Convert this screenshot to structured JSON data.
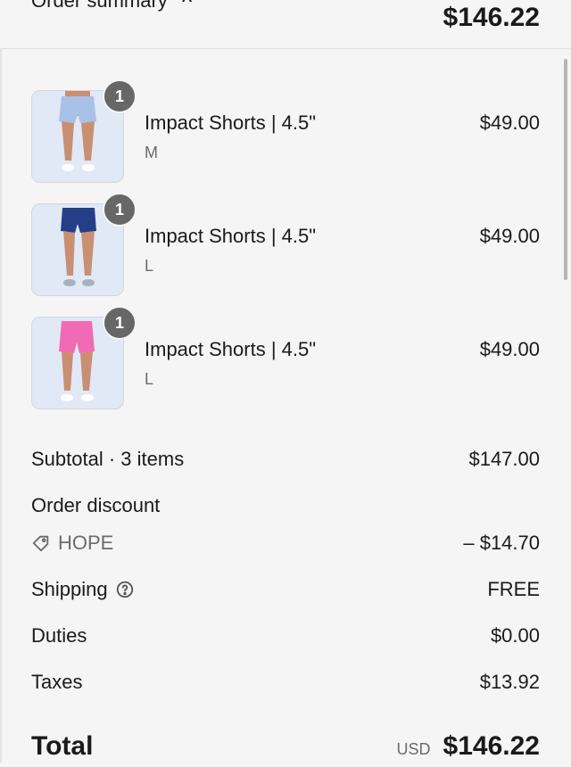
{
  "header": {
    "toggle_label": "Order summary",
    "total": "$146.22"
  },
  "items": [
    {
      "qty": "1",
      "name": "Impact Shorts | 4.5\"",
      "variant": "M",
      "price": "$49.00",
      "color": "#a8c1e6"
    },
    {
      "qty": "1",
      "name": "Impact Shorts | 4.5\"",
      "variant": "L",
      "price": "$49.00",
      "color": "#243f86"
    },
    {
      "qty": "1",
      "name": "Impact Shorts | 4.5\"",
      "variant": "L",
      "price": "$49.00",
      "color": "#f06bb3"
    }
  ],
  "summary": {
    "subtotal_label": "Subtotal · 3 items",
    "subtotal": "$147.00",
    "discount_label": "Order discount",
    "discount_code": "HOPE",
    "discount_amount": "– $14.70",
    "shipping_label": "Shipping",
    "shipping_value": "FREE",
    "duties_label": "Duties",
    "duties_value": "$0.00",
    "taxes_label": "Taxes",
    "taxes_value": "$13.92",
    "total_label": "Total",
    "currency": "USD",
    "total": "$146.22"
  },
  "icons": {
    "toggle": "chevron-up-icon",
    "discount": "tag-icon",
    "shipping": "help-circle-icon"
  }
}
